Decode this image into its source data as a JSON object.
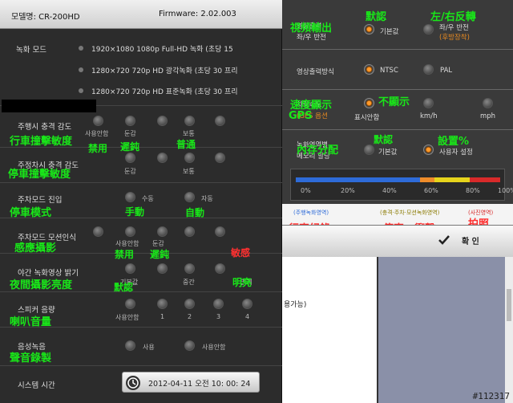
{
  "header": {
    "model": "모델명: CR-200HD",
    "firmware": "Firmware: 2.02.003"
  },
  "record_mode": {
    "label": "녹화 모드",
    "options": [
      "1920×1080 1080p Full-HD 녹화 (초당 15",
      "1280×720 720p HD 광각녹화 (초당 30 프리",
      "1280×720 720p HD 표준녹화 (초당 30 프리"
    ]
  },
  "drive_impact": {
    "label": "주행시 충격 감도",
    "options": [
      "사용안함",
      "둔감",
      "보통"
    ],
    "ann": [
      "行車撞擊敏度",
      "禁用",
      "遲鈍",
      "普通"
    ]
  },
  "park_impact": {
    "label": "주정차시 충격 감도",
    "options": [
      "둔감",
      "보통"
    ],
    "ann": "停車撞擊敏度"
  },
  "park_entry": {
    "label": "주차모드 진입",
    "options": [
      "수동",
      "자동"
    ],
    "ann": [
      "停車模式",
      "手動",
      "自動"
    ]
  },
  "park_motion": {
    "label": "주차모드 모션인식",
    "options": [
      "사용안함",
      "둔감"
    ],
    "ann": [
      "感應攝影",
      "禁用",
      "遲鈍",
      "敏感"
    ]
  },
  "night": {
    "label": "야간 녹화영상 밝기",
    "options": [
      "기본값",
      "중간",
      "밝게"
    ],
    "ann": [
      "夜間攝影亮度",
      "默認",
      "明亮"
    ]
  },
  "speaker": {
    "label": "스피커 음량",
    "options": [
      "사용안함",
      "1",
      "2",
      "3",
      "4"
    ],
    "ann": "喇叭音量"
  },
  "voice": {
    "label": "음성녹음",
    "options": [
      "사용",
      "사용안함"
    ],
    "ann": "聲音錄製"
  },
  "clock": {
    "label": "시스템 시간",
    "value": "2012-04-11 오전 10: 00: 24",
    "icon": "clock-icon"
  },
  "right": {
    "video_out": {
      "label1": "영상출력",
      "label2": "좌/우 반전",
      "opt1": "기본값",
      "opt2": "좌/우 반전",
      "opt2sub": "(후방장착)",
      "ann": [
        "視頻輸出",
        "默認",
        "左/右反轉"
      ]
    },
    "video_method": {
      "label": "영상출력방식",
      "opt1": "NTSC",
      "opt2": "PAL"
    },
    "speed": {
      "label": "차량속도",
      "label2": "(GPS 옵션",
      "opt1": "표시안함",
      "opt2": "km/h",
      "opt3": "mph",
      "ann": [
        "速度顯示",
        "GPS",
        "不顯示"
      ]
    },
    "memory": {
      "label1": "녹화영역별",
      "label2": "메모리 할당",
      "opt1": "기본값",
      "opt2": "사용자 설정",
      "ann": [
        "內存分配",
        "默認",
        "設置%"
      ]
    },
    "ticks": [
      "0%",
      "20%",
      "40%",
      "60%",
      "80%",
      "100%"
    ],
    "legend": [
      "(주행녹화영역)",
      "(충격·주차·모션녹화영역)",
      "(사진영역)"
    ],
    "legend_ann": [
      "行車紀錄",
      "停車、衝擊",
      "拍照"
    ],
    "confirm": "확 인"
  },
  "fragment": "용가능)",
  "watermark": "#112317"
}
